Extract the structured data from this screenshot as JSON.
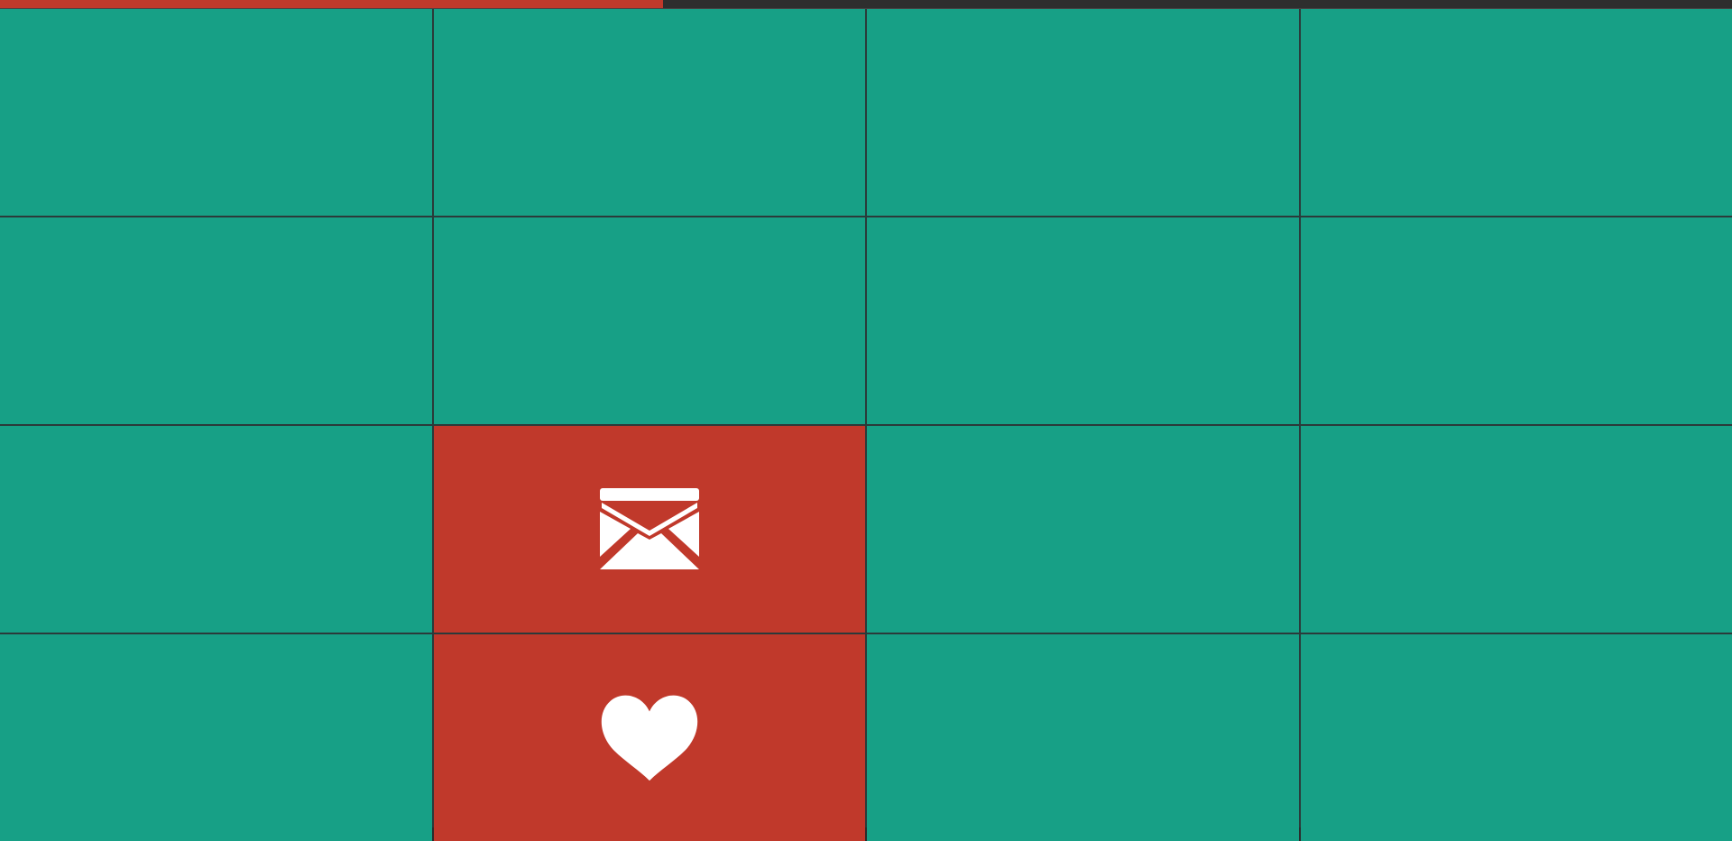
{
  "progress": {
    "fraction": 0.383,
    "fill_color": "#c0392b",
    "track_color": "#2e2e2e"
  },
  "colors": {
    "tile_hidden": "#17a086",
    "tile_revealed": "#c0392b",
    "grid_line": "#2b3a3a",
    "icon": "#ffffff"
  },
  "board": {
    "rows": 4,
    "cols": 4,
    "tiles": [
      {
        "row": 0,
        "col": 0,
        "state": "hidden",
        "icon": ""
      },
      {
        "row": 0,
        "col": 1,
        "state": "hidden",
        "icon": ""
      },
      {
        "row": 0,
        "col": 2,
        "state": "hidden",
        "icon": ""
      },
      {
        "row": 0,
        "col": 3,
        "state": "hidden",
        "icon": ""
      },
      {
        "row": 1,
        "col": 0,
        "state": "hidden",
        "icon": ""
      },
      {
        "row": 1,
        "col": 1,
        "state": "hidden",
        "icon": ""
      },
      {
        "row": 1,
        "col": 2,
        "state": "hidden",
        "icon": ""
      },
      {
        "row": 1,
        "col": 3,
        "state": "hidden",
        "icon": ""
      },
      {
        "row": 2,
        "col": 0,
        "state": "hidden",
        "icon": ""
      },
      {
        "row": 2,
        "col": 1,
        "state": "revealed",
        "icon": "envelope-icon"
      },
      {
        "row": 2,
        "col": 2,
        "state": "hidden",
        "icon": ""
      },
      {
        "row": 2,
        "col": 3,
        "state": "hidden",
        "icon": ""
      },
      {
        "row": 3,
        "col": 0,
        "state": "hidden",
        "icon": ""
      },
      {
        "row": 3,
        "col": 1,
        "state": "revealed",
        "icon": "heart-icon"
      },
      {
        "row": 3,
        "col": 2,
        "state": "hidden",
        "icon": ""
      },
      {
        "row": 3,
        "col": 3,
        "state": "hidden",
        "icon": ""
      }
    ]
  }
}
